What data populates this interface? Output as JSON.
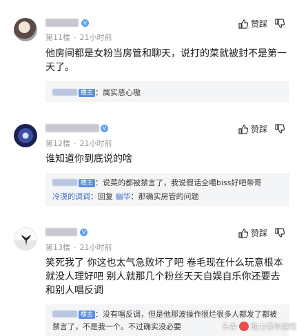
{
  "like_label": "赞踩",
  "comments": [
    {
      "floor": "第11楼",
      "time": "21小时前",
      "text": "他房间都是女粉当房管和聊天，说打的菜就被封不是第一天了。",
      "replies": [
        {
          "name_badge": "楼主",
          "text": "属实恶心嗷"
        }
      ]
    },
    {
      "floor": "第12楼",
      "time": "21小时前",
      "text": "谁知道你到底说的啥",
      "replies": [
        {
          "name_badge": "楼主",
          "text": "说菜的都被禁言了，我说假话全噶biss好吧带哥"
        },
        {
          "name": "冷漠的调调",
          "reply_word": "回复",
          "target": "幽华",
          "text": "那确实房管的问题"
        }
      ]
    },
    {
      "floor": "第13楼",
      "time": "21小时前",
      "text": "笑死我了 你这也太气急败坏了吧 卷毛现在什么玩意根本就没人理好吧 别人就那几个粉丝天天自娱自乐你还要去和别人唱反调",
      "replies": [
        {
          "name_badge": "楼主",
          "text": "没有唱反调，但是他那波操作很烂很多人都发了都被禁言了，不是我一个。不过确实没必要"
        }
      ]
    }
  ],
  "watermark": {
    "prefix": "头条",
    "account": "助力青年游戏"
  }
}
